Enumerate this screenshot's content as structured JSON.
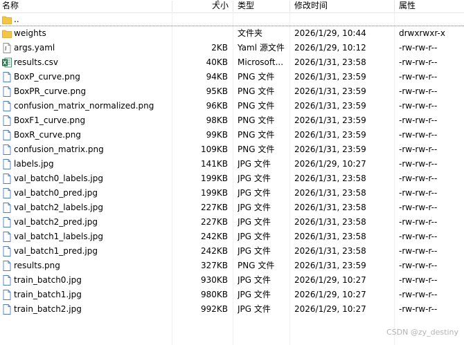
{
  "header": {
    "name": "名称",
    "size": "大小",
    "type": "类型",
    "modified": "修改时间",
    "attributes": "属性"
  },
  "parent_row": {
    "name": ".."
  },
  "rows": [
    {
      "name": "weights",
      "size": "",
      "type": "文件夹",
      "date": "2026/1/29, 10:44",
      "perm": "drwxrwxr-x",
      "icon": "folder-icon"
    },
    {
      "name": "args.yaml",
      "size": "2KB",
      "type": "Yaml 源文件",
      "date": "2026/1/29, 10:12",
      "perm": "-rw-rw-r--",
      "icon": "text-file-icon"
    },
    {
      "name": "results.csv",
      "size": "40KB",
      "type": "Microsoft...",
      "date": "2026/1/31, 23:58",
      "perm": "-rw-rw-r--",
      "icon": "excel-file-icon"
    },
    {
      "name": "BoxP_curve.png",
      "size": "94KB",
      "type": "PNG 文件",
      "date": "2026/1/31, 23:59",
      "perm": "-rw-rw-r--",
      "icon": "image-file-icon"
    },
    {
      "name": "BoxPR_curve.png",
      "size": "95KB",
      "type": "PNG 文件",
      "date": "2026/1/31, 23:59",
      "perm": "-rw-rw-r--",
      "icon": "image-file-icon"
    },
    {
      "name": "confusion_matrix_normalized.png",
      "size": "96KB",
      "type": "PNG 文件",
      "date": "2026/1/31, 23:59",
      "perm": "-rw-rw-r--",
      "icon": "image-file-icon"
    },
    {
      "name": "BoxF1_curve.png",
      "size": "98KB",
      "type": "PNG 文件",
      "date": "2026/1/31, 23:59",
      "perm": "-rw-rw-r--",
      "icon": "image-file-icon"
    },
    {
      "name": "BoxR_curve.png",
      "size": "99KB",
      "type": "PNG 文件",
      "date": "2026/1/31, 23:59",
      "perm": "-rw-rw-r--",
      "icon": "image-file-icon"
    },
    {
      "name": "confusion_matrix.png",
      "size": "109KB",
      "type": "PNG 文件",
      "date": "2026/1/31, 23:59",
      "perm": "-rw-rw-r--",
      "icon": "image-file-icon"
    },
    {
      "name": "labels.jpg",
      "size": "141KB",
      "type": "JPG 文件",
      "date": "2026/1/29, 10:27",
      "perm": "-rw-rw-r--",
      "icon": "image-file-icon"
    },
    {
      "name": "val_batch0_labels.jpg",
      "size": "199KB",
      "type": "JPG 文件",
      "date": "2026/1/31, 23:58",
      "perm": "-rw-rw-r--",
      "icon": "image-file-icon"
    },
    {
      "name": "val_batch0_pred.jpg",
      "size": "199KB",
      "type": "JPG 文件",
      "date": "2026/1/31, 23:58",
      "perm": "-rw-rw-r--",
      "icon": "image-file-icon"
    },
    {
      "name": "val_batch2_labels.jpg",
      "size": "227KB",
      "type": "JPG 文件",
      "date": "2026/1/31, 23:58",
      "perm": "-rw-rw-r--",
      "icon": "image-file-icon"
    },
    {
      "name": "val_batch2_pred.jpg",
      "size": "227KB",
      "type": "JPG 文件",
      "date": "2026/1/31, 23:58",
      "perm": "-rw-rw-r--",
      "icon": "image-file-icon"
    },
    {
      "name": "val_batch1_labels.jpg",
      "size": "242KB",
      "type": "JPG 文件",
      "date": "2026/1/31, 23:58",
      "perm": "-rw-rw-r--",
      "icon": "image-file-icon"
    },
    {
      "name": "val_batch1_pred.jpg",
      "size": "242KB",
      "type": "JPG 文件",
      "date": "2026/1/31, 23:58",
      "perm": "-rw-rw-r--",
      "icon": "image-file-icon"
    },
    {
      "name": "results.png",
      "size": "327KB",
      "type": "PNG 文件",
      "date": "2026/1/31, 23:59",
      "perm": "-rw-rw-r--",
      "icon": "image-file-icon"
    },
    {
      "name": "train_batch0.jpg",
      "size": "930KB",
      "type": "JPG 文件",
      "date": "2026/1/29, 10:27",
      "perm": "-rw-rw-r--",
      "icon": "image-file-icon"
    },
    {
      "name": "train_batch1.jpg",
      "size": "980KB",
      "type": "JPG 文件",
      "date": "2026/1/29, 10:27",
      "perm": "-rw-rw-r--",
      "icon": "image-file-icon"
    },
    {
      "name": "train_batch2.jpg",
      "size": "992KB",
      "type": "JPG 文件",
      "date": "2026/1/29, 10:27",
      "perm": "-rw-rw-r--",
      "icon": "image-file-icon"
    }
  ],
  "watermark": "CSDN @zy_destiny",
  "colors": {
    "folder": "#f6c444",
    "image_icon_stroke": "#4a7cc4",
    "excel": "#1e7145"
  }
}
